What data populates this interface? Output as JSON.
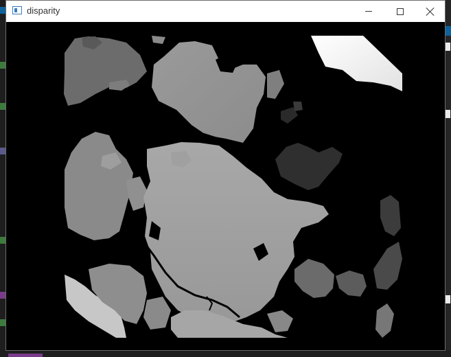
{
  "window": {
    "title": "disparity",
    "icon": "opencv-window-icon",
    "controls": [
      "minimize-icon",
      "maximize-icon",
      "close-icon"
    ]
  },
  "image": {
    "kind": "disparity-map",
    "colormap": "grayscale"
  },
  "colors": {
    "titlebar": "#ffffff",
    "background": "#000000",
    "accent": "#0e639c"
  }
}
